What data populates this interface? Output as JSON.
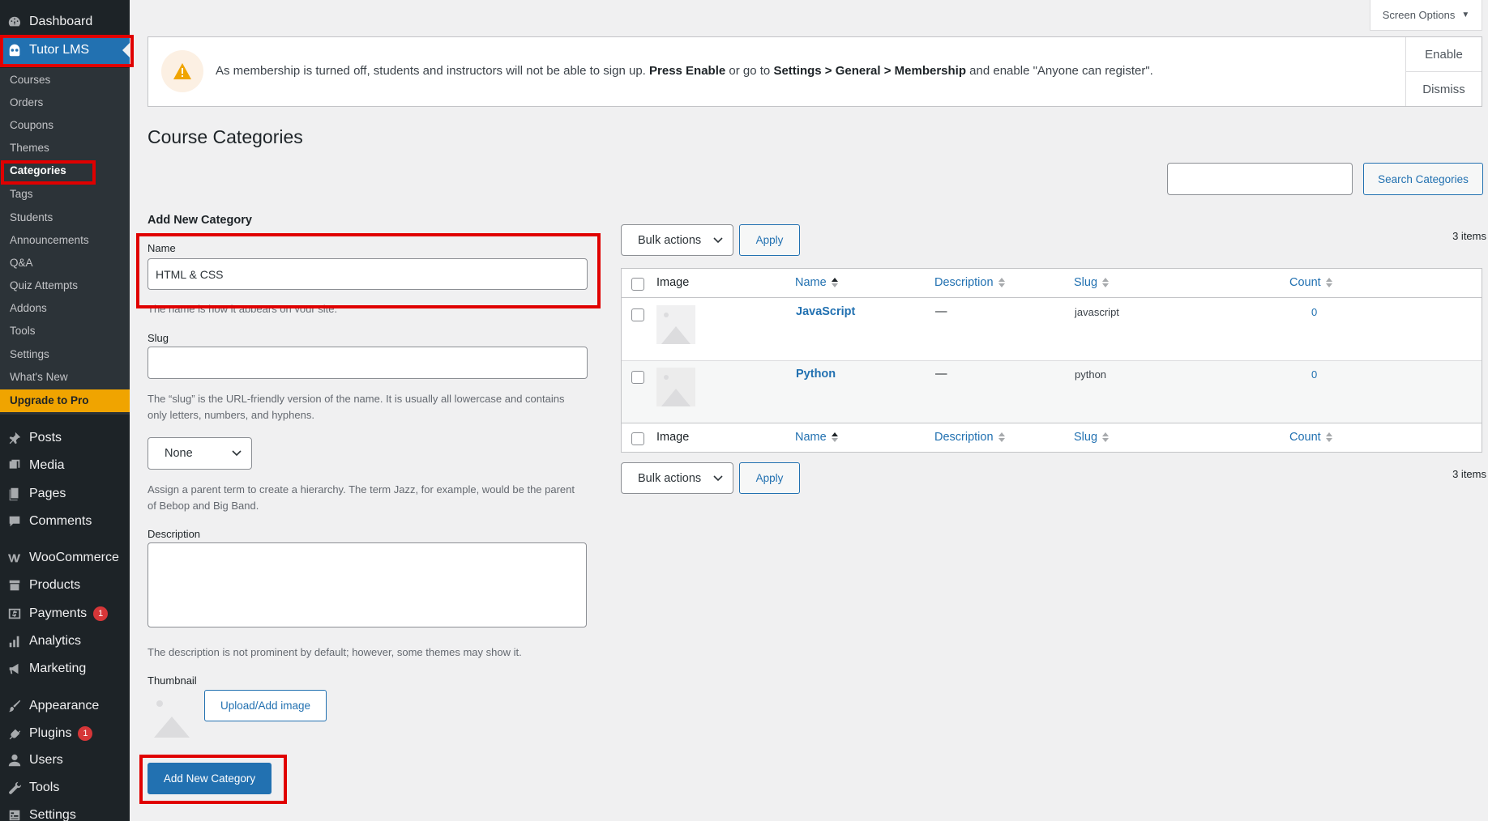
{
  "sidebar": {
    "top": [
      {
        "label": "Dashboard",
        "icon": "dashboard-icon"
      },
      {
        "label": "Tutor LMS",
        "icon": "tutor-owl-icon"
      }
    ],
    "submenu": [
      "Courses",
      "Orders",
      "Coupons",
      "Themes",
      "Categories",
      "Tags",
      "Students",
      "Announcements",
      "Q&A",
      "Quiz Attempts",
      "Addons",
      "Tools",
      "Settings",
      "What's New"
    ],
    "upgrade": "Upgrade to Pro",
    "bottom": [
      {
        "label": "Posts",
        "icon": "pin-icon"
      },
      {
        "label": "Media",
        "icon": "media-icon"
      },
      {
        "label": "Pages",
        "icon": "pages-icon"
      },
      {
        "label": "Comments",
        "icon": "comment-icon"
      },
      {
        "label": "WooCommerce",
        "icon": "woo-icon"
      },
      {
        "label": "Products",
        "icon": "archive-icon"
      },
      {
        "label": "Payments",
        "icon": "dollar-icon",
        "badge": "1"
      },
      {
        "label": "Analytics",
        "icon": "bar-chart-icon"
      },
      {
        "label": "Marketing",
        "icon": "megaphone-icon"
      },
      {
        "label": "Appearance",
        "icon": "brush-icon"
      },
      {
        "label": "Plugins",
        "icon": "plug-icon",
        "badge": "1"
      },
      {
        "label": "Users",
        "icon": "user-icon"
      },
      {
        "label": "Tools",
        "icon": "wrench-icon"
      },
      {
        "label": "Settings",
        "icon": "settings-icon"
      }
    ]
  },
  "screen_options": "Screen Options",
  "notice": {
    "text1": "As membership is turned off, students and instructors will not be able to sign up. ",
    "bold1": "Press Enable",
    "text2": " or go to ",
    "bold2": "Settings > General > Membership",
    "text3": " and enable \"Anyone can register\".",
    "enable": "Enable",
    "dismiss": "Dismiss"
  },
  "page_title": "Course Categories",
  "search": {
    "placeholder": "",
    "button": "Search Categories"
  },
  "form": {
    "heading": "Add New Category",
    "name_label": "Name",
    "name_value": "HTML & CSS",
    "name_help": "The name is how it appears on your site.",
    "slug_label": "Slug",
    "slug_value": "",
    "slug_help": "The “slug” is the URL-friendly version of the name. It is usually all lowercase and contains only letters, numbers, and hyphens.",
    "parent_value": "None",
    "parent_help": "Assign a parent term to create a hierarchy. The term Jazz, for example, would be the parent of Bebop and Big Band.",
    "desc_label": "Description",
    "desc_value": "",
    "desc_help": "The description is not prominent by default; however, some themes may show it.",
    "thumb_label": "Thumbnail",
    "upload_button": "Upload/Add image",
    "submit": "Add New Category"
  },
  "list": {
    "bulk_actions": "Bulk actions",
    "apply": "Apply",
    "items_count": "3 items",
    "columns": {
      "image": "Image",
      "name": "Name",
      "description": "Description",
      "slug": "Slug",
      "count": "Count"
    },
    "rows": [
      {
        "name": "JavaScript",
        "description": "—",
        "slug": "javascript",
        "count": "0"
      },
      {
        "name": "Python",
        "description": "—",
        "slug": "python",
        "count": "0"
      }
    ]
  },
  "colors": {
    "accent": "#2271b1",
    "highlight": "#e00000",
    "upgrade": "#f0a400",
    "sidebar": "#1d2327"
  }
}
